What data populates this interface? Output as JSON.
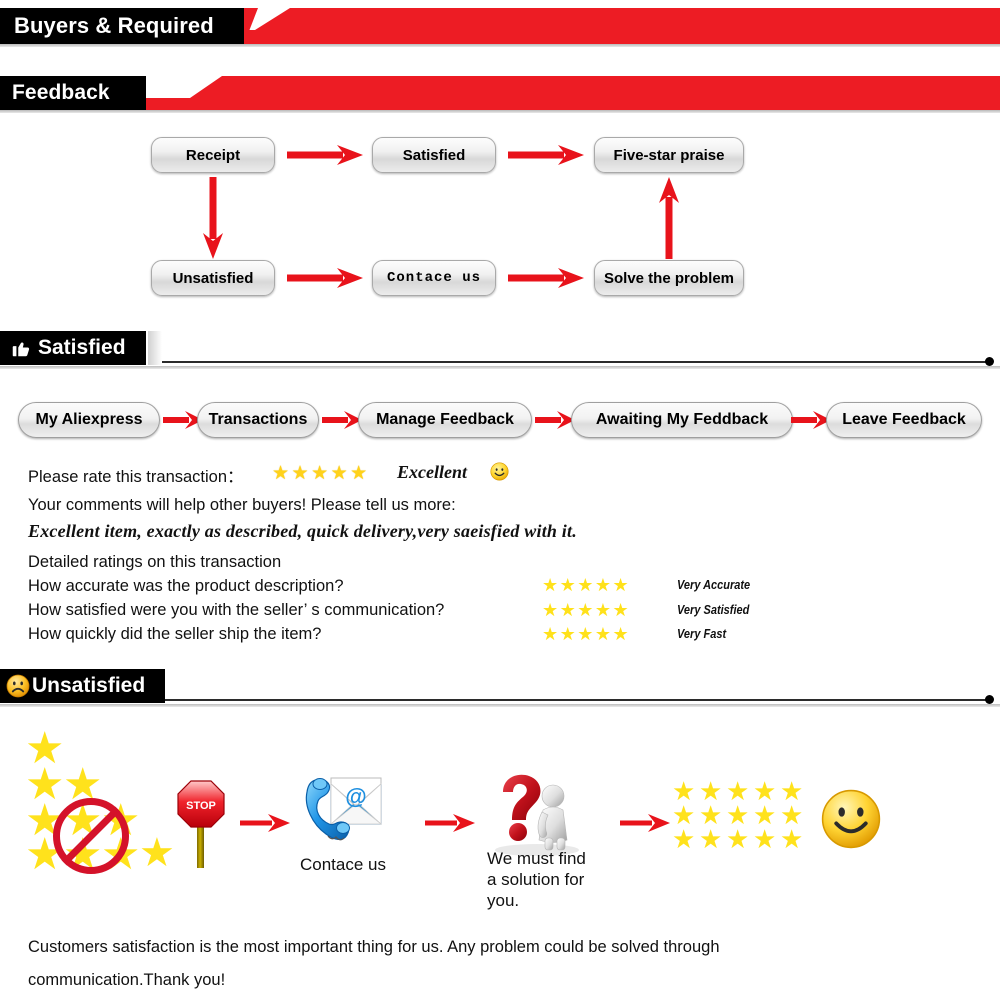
{
  "headers": {
    "buyers": "Buyers & Required",
    "feedback": "Feedback",
    "satisfied": "Satisfied",
    "unsatisfied": "Unsatisfied",
    "satisfied_icon": "thumbs-up-icon",
    "unsatisfied_icon": "sad-face-icon"
  },
  "colors": {
    "banner_red": "#ED1C24",
    "banner_black": "#000000",
    "arrow_red": "#E8131B",
    "star_yellow": "#FFE21C",
    "rule_black": "#2B2B2B"
  },
  "flowchart": {
    "nodes": [
      {
        "id": "receipt",
        "label": "Receipt"
      },
      {
        "id": "satisfied",
        "label": "Satisfied"
      },
      {
        "id": "five-star-praise",
        "label": "Five-star praise"
      },
      {
        "id": "unsatisfied",
        "label": "Unsatisfied"
      },
      {
        "id": "contace-us",
        "label": "Contace us"
      },
      {
        "id": "solve-the-problem",
        "label": "Solve the problem"
      }
    ]
  },
  "breadcrumbs": [
    {
      "label": "My Aliexpress"
    },
    {
      "label": "Transactions"
    },
    {
      "label": "Manage Feedback"
    },
    {
      "label": "Awaiting My Feddback"
    },
    {
      "label": "Leave Feedback"
    }
  ],
  "rating": {
    "prompt": "Please rate this transaction：",
    "stars": "★★★★★",
    "star_count": 5,
    "verdict": "Excellent",
    "smiley_icon": "smiley-face-icon",
    "comments_prompt": "Your comments will help other buyers! Please tell us more:",
    "comment_text": "Excellent item, exactly as described, quick delivery,very saeisfied with it.",
    "detailed_title": "Detailed ratings on this transaction",
    "detailed_rows": [
      {
        "question": "How accurate was the product description?",
        "stars": "★★★★★",
        "star_count": 5,
        "label": "Very Accurate"
      },
      {
        "question": "How satisfied were you with the seller’ s communication?",
        "stars": "★★★★★",
        "star_count": 5,
        "label": "Very Satisfied"
      },
      {
        "question": "How quickly did the seller ship the item?",
        "stars": "★★★★★",
        "star_count": 5,
        "label": "Very Fast"
      }
    ]
  },
  "illustration": {
    "bad_stars_icon": "crossed-out-stars-icon",
    "stop_sign_icon": "stop-sign-icon",
    "stop_sign_label": "STOP",
    "contact_icon": "phone-email-icon",
    "contact_caption": "Contace us",
    "question_icon": "question-mark-person-icon",
    "question_caption": "We must find\na solution for\nyou.",
    "question_caption_l1": "We must find",
    "question_caption_l2": "a solution for",
    "question_caption_l3": "you.",
    "good_stars_icon": "five-star-grid-icon",
    "good_star_rows": 3,
    "good_star_cols": 5,
    "happy_icon": "smiley-face-icon"
  },
  "footer": {
    "line1": "Customers satisfaction is the most important thing for us. Any problem could be solved through",
    "line2": "communication.Thank you!"
  }
}
